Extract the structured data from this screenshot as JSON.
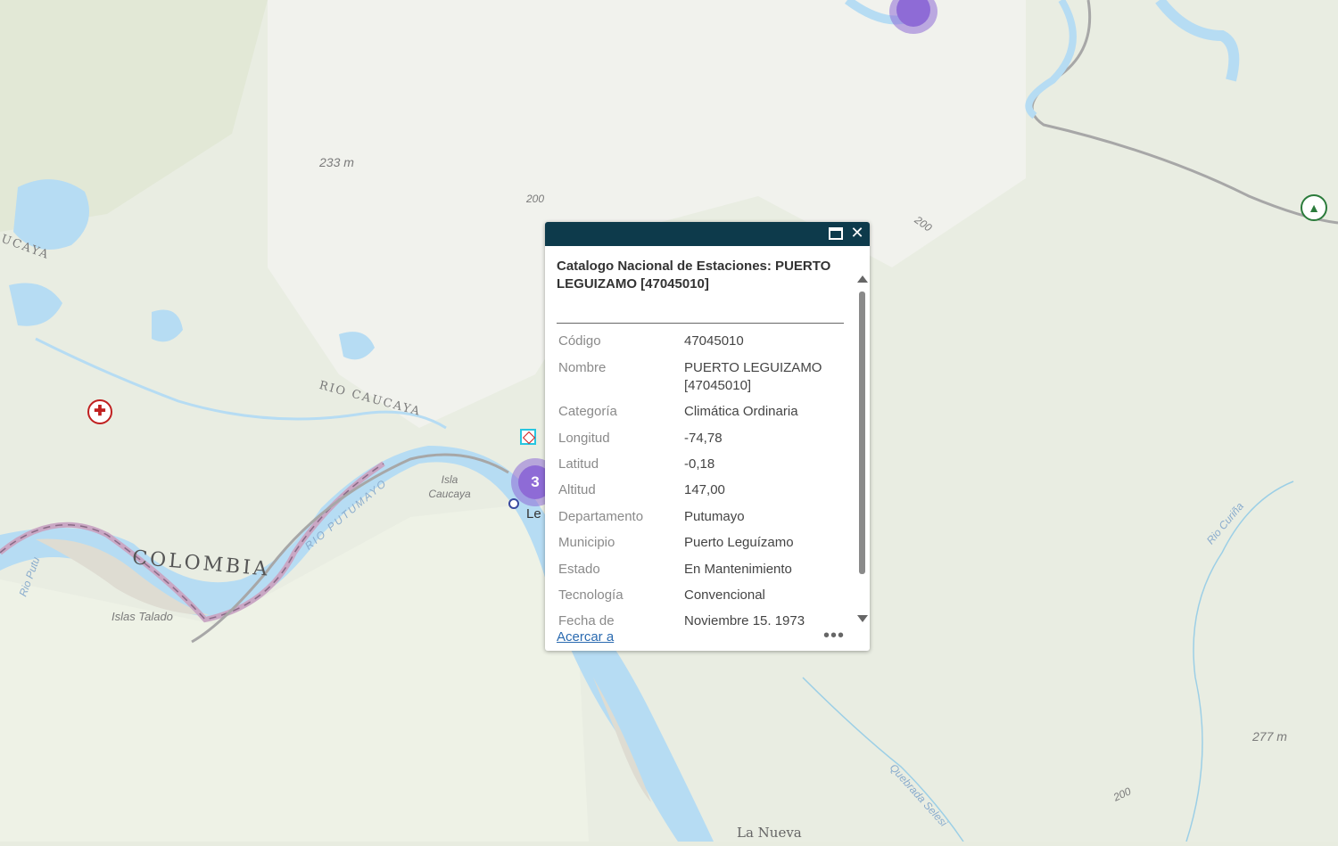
{
  "map": {
    "labels": {
      "elev_233": "233 m",
      "contour_200_a": "200",
      "contour_200_b": "200",
      "contour_200_c": "200",
      "elev_277": "277 m",
      "rio_caucaya_left": "UCAYA",
      "rio_caucaya": "RIO CAUCAYA",
      "isla_caucaya": "Isla Caucaya",
      "rio_pitumayo": "RIO PUTUMAYO",
      "colombia": "COLOMBIA",
      "rio_putu": "Rio Putu",
      "islas_talado": "Islas Talado",
      "rio_curina": "Rio Curiña",
      "quebrada_selesi": "Quebrada Selesi",
      "la_nueva": "La Nueva",
      "town_partial": "Le"
    },
    "cluster_count": "3",
    "colors": {
      "water": "#b6dcf3",
      "land": "#e8ece0",
      "border": "#c9a7c4",
      "road": "#a7a7a7",
      "cluster": "#8e6bd6"
    },
    "icons": [
      "hospital-icon",
      "campground-icon",
      "station-marker-icon"
    ]
  },
  "popup": {
    "title": "Catalogo Nacional de Estaciones: PUERTO LEGUIZAMO [47045010]",
    "attributes": [
      {
        "key": "Código",
        "value": "47045010"
      },
      {
        "key": "Nombre",
        "value": "PUERTO LEGUIZAMO [47045010]"
      },
      {
        "key": "Categoría",
        "value": "Climática Ordinaria"
      },
      {
        "key": "Longitud",
        "value": "-74,78"
      },
      {
        "key": "Latitud",
        "value": "-0,18"
      },
      {
        "key": "Altitud",
        "value": "147,00"
      },
      {
        "key": "Departamento",
        "value": "Putumayo"
      },
      {
        "key": "Municipio",
        "value": "Puerto Leguízamo"
      },
      {
        "key": "Estado",
        "value": "En Mantenimiento"
      },
      {
        "key": "Tecnología",
        "value": "Convencional"
      },
      {
        "key": "Fecha de Instalación",
        "value": "Noviembre 15, 1973"
      }
    ],
    "zoom_link": "Acercar a",
    "more": "•••",
    "maximize_icon": "maximize-icon",
    "close_icon": "close-icon"
  }
}
